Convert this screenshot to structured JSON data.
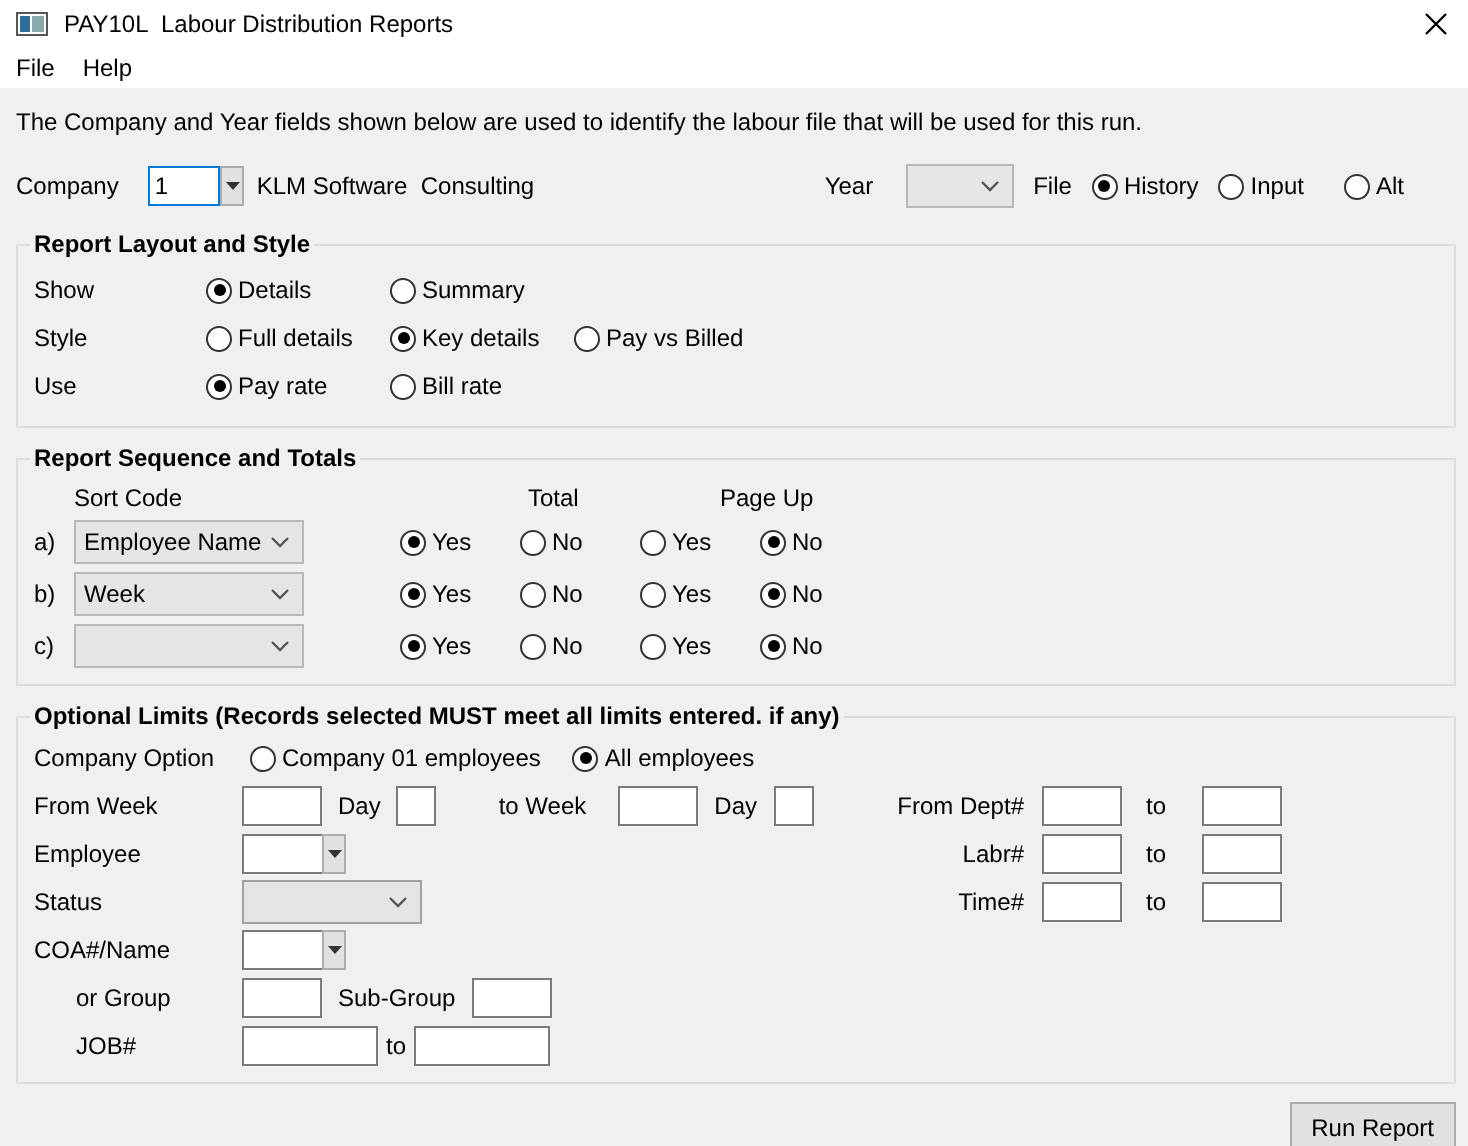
{
  "window": {
    "title": "PAY10L  Labour Distribution Reports"
  },
  "menu": [
    "File",
    "Help"
  ],
  "intro": "The Company and Year fields shown below are used to identify the labour file that will be used for this run.",
  "company": {
    "label": "Company",
    "value": "1",
    "name": "KLM Software  Consulting"
  },
  "year": {
    "label": "Year"
  },
  "file": {
    "label": "File",
    "options": [
      {
        "label": "History",
        "selected": true
      },
      {
        "label": "Input",
        "selected": false
      },
      {
        "label": "Alt",
        "selected": false
      }
    ]
  },
  "layout": {
    "title": "Report Layout and Style",
    "rows": [
      {
        "label": "Show",
        "options": [
          {
            "label": "Details",
            "selected": true
          },
          {
            "label": "Summary",
            "selected": false
          }
        ]
      },
      {
        "label": "Style",
        "options": [
          {
            "label": "Full details",
            "selected": false
          },
          {
            "label": "Key details",
            "selected": true
          },
          {
            "label": "Pay vs Billed",
            "selected": false
          }
        ]
      },
      {
        "label": "Use",
        "options": [
          {
            "label": "Pay rate",
            "selected": true
          },
          {
            "label": "Bill rate",
            "selected": false
          }
        ]
      }
    ]
  },
  "sequence": {
    "title": "Report Sequence and Totals",
    "headers": [
      "Sort Code",
      "Total",
      "Page Up"
    ],
    "rows": [
      {
        "letter": "a)",
        "sort": "Employee Name",
        "total": [
          {
            "label": "Yes",
            "selected": true
          },
          {
            "label": "No",
            "selected": false
          }
        ],
        "page_up": [
          {
            "label": "Yes",
            "selected": false
          },
          {
            "label": "No",
            "selected": true
          }
        ]
      },
      {
        "letter": "b)",
        "sort": "Week",
        "total": [
          {
            "label": "Yes",
            "selected": true
          },
          {
            "label": "No",
            "selected": false
          }
        ],
        "page_up": [
          {
            "label": "Yes",
            "selected": false
          },
          {
            "label": "No",
            "selected": true
          }
        ]
      },
      {
        "letter": "c)",
        "total": [
          {
            "label": "Yes",
            "selected": true
          },
          {
            "label": "No",
            "selected": false
          }
        ],
        "page_up": [
          {
            "label": "Yes",
            "selected": false
          },
          {
            "label": "No",
            "selected": true
          }
        ]
      }
    ]
  },
  "limits": {
    "title": "Optional Limits (Records selected MUST meet all limits entered. if any)",
    "company_option": {
      "label": "Company Option",
      "options": [
        {
          "label": "Company 01 employees",
          "selected": false
        },
        {
          "label": "All employees",
          "selected": true
        }
      ]
    },
    "rows": [
      {
        "left": [
          {
            "kind": "caption",
            "text": "From Week"
          },
          {
            "kind": "field"
          },
          {
            "kind": "text",
            "text": "Day"
          },
          {
            "kind": "tiny"
          },
          {
            "kind": "gaptext",
            "text": "to Week"
          },
          {
            "kind": "field"
          },
          {
            "kind": "text",
            "text": "Day"
          },
          {
            "kind": "tiny"
          }
        ],
        "right": {
          "label": "From Dept#",
          "to": "to"
        }
      },
      {
        "left": [
          {
            "kind": "caption",
            "text": "Employee"
          },
          {
            "kind": "combo"
          }
        ],
        "right": {
          "label": "Labr#",
          "to": "to"
        }
      },
      {
        "left": [
          {
            "kind": "caption",
            "text": "Status"
          },
          {
            "kind": "select"
          }
        ],
        "right": {
          "label": "Time#",
          "to": "to"
        }
      },
      {
        "left": [
          {
            "kind": "caption",
            "text": "COA#/Name"
          },
          {
            "kind": "combo"
          }
        ]
      },
      {
        "left": [
          {
            "kind": "subcaption",
            "text": "or Group"
          },
          {
            "kind": "field"
          },
          {
            "kind": "text",
            "text": "Sub-Group"
          },
          {
            "kind": "field"
          }
        ]
      },
      {
        "left": [
          {
            "kind": "subcaption",
            "text": "JOB#"
          },
          {
            "kind": "long"
          },
          {
            "kind": "short",
            "text": "to"
          },
          {
            "kind": "long"
          }
        ]
      }
    ]
  },
  "run_button": "Run Report"
}
